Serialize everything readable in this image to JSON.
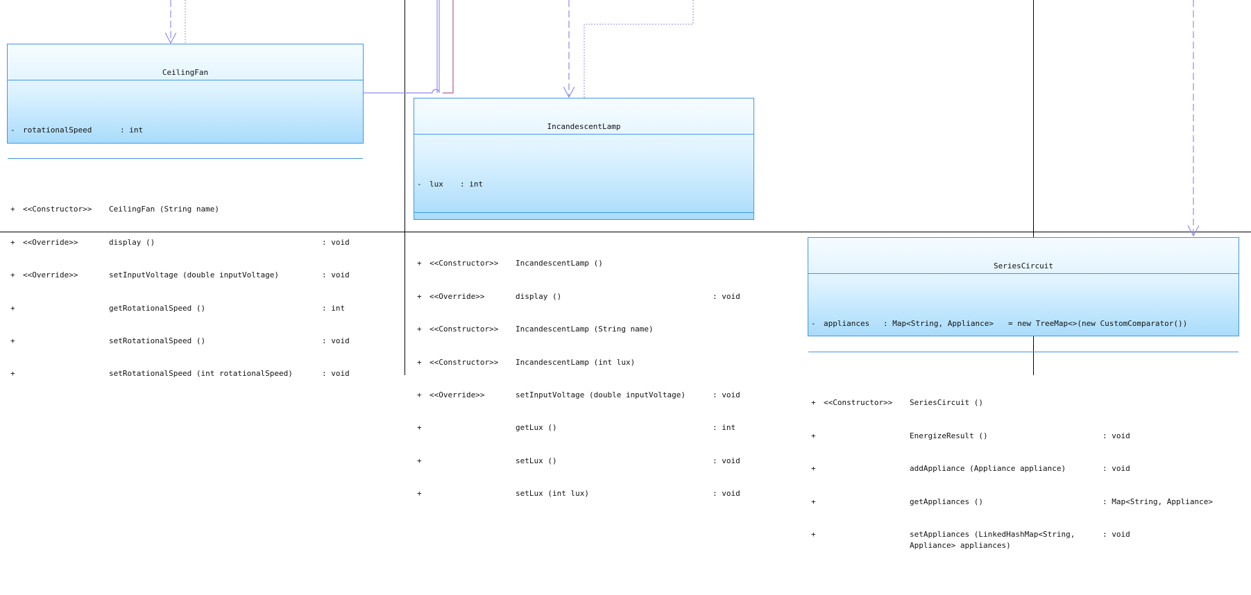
{
  "diagram": {
    "classes": [
      {
        "id": "ceilingfan",
        "name": "CeilingFan",
        "attributes": [
          {
            "vis": "-",
            "name": "rotationalSpeed",
            "type": ": int"
          }
        ],
        "methods": [
          {
            "vis": "+",
            "stereo": "<<Constructor>>",
            "sig": "CeilingFan (String name)",
            "ret": ""
          },
          {
            "vis": "+",
            "stereo": "<<Override>>",
            "sig": "display ()",
            "ret": ": void"
          },
          {
            "vis": "+",
            "stereo": "<<Override>>",
            "sig": "setInputVoltage (double inputVoltage)",
            "ret": ": void"
          },
          {
            "vis": "+",
            "stereo": "",
            "sig": "getRotationalSpeed ()",
            "ret": ": int"
          },
          {
            "vis": "+",
            "stereo": "",
            "sig": "setRotationalSpeed ()",
            "ret": ": void"
          },
          {
            "vis": "+",
            "stereo": "",
            "sig": "setRotationalSpeed (int rotationalSpeed)",
            "ret": ": void"
          }
        ]
      },
      {
        "id": "incandescentlamp",
        "name": "IncandescentLamp",
        "attributes": [
          {
            "vis": "-",
            "name": "lux",
            "type": ": int"
          }
        ],
        "methods": [
          {
            "vis": "+",
            "stereo": "<<Constructor>>",
            "sig": "IncandescentLamp ()",
            "ret": ""
          },
          {
            "vis": "+",
            "stereo": "<<Override>>",
            "sig": "display ()",
            "ret": ": void"
          },
          {
            "vis": "+",
            "stereo": "<<Constructor>>",
            "sig": "IncandescentLamp (String name)",
            "ret": ""
          },
          {
            "vis": "+",
            "stereo": "<<Constructor>>",
            "sig": "IncandescentLamp (int lux)",
            "ret": ""
          },
          {
            "vis": "+",
            "stereo": "<<Override>>",
            "sig": "setInputVoltage (double inputVoltage)",
            "ret": ": void"
          },
          {
            "vis": "+",
            "stereo": "",
            "sig": "getLux ()",
            "ret": ": int"
          },
          {
            "vis": "+",
            "stereo": "",
            "sig": "setLux ()",
            "ret": ": void"
          },
          {
            "vis": "+",
            "stereo": "",
            "sig": "setLux (int lux)",
            "ret": ": void"
          }
        ]
      },
      {
        "id": "seriescircuit",
        "name": "SeriesCircuit",
        "attributes": [
          {
            "vis": "-",
            "name": "appliances",
            "type": ": Map<String, Appliance>",
            "init": "= new TreeMap<>(new CustomComparator())"
          }
        ],
        "methods": [
          {
            "vis": "+",
            "stereo": "<<Constructor>>",
            "sig": "SeriesCircuit ()",
            "ret": ""
          },
          {
            "vis": "+",
            "stereo": "",
            "sig": "EnergizeResult ()",
            "ret": ": void"
          },
          {
            "vis": "+",
            "stereo": "",
            "sig": "addAppliance (Appliance appliance)",
            "ret": ": void"
          },
          {
            "vis": "+",
            "stereo": "",
            "sig": "getAppliances ()",
            "ret": ": Map<String, Appliance>"
          },
          {
            "vis": "+",
            "stereo": "",
            "sig": "setAppliances (LinkedHashMap<String, Appliance> appliances)",
            "ret": ": void",
            "wrap": true
          }
        ]
      }
    ],
    "colors": {
      "class_border": "#3f95e8",
      "class_fill_top": "#f6fcff",
      "class_fill_bottom": "#a9dcfb",
      "association_line": "#8c8cf0",
      "dependency_line": "#8c8cf0",
      "composition_line": "#b25c8c",
      "page_break_line": "#000000"
    }
  }
}
